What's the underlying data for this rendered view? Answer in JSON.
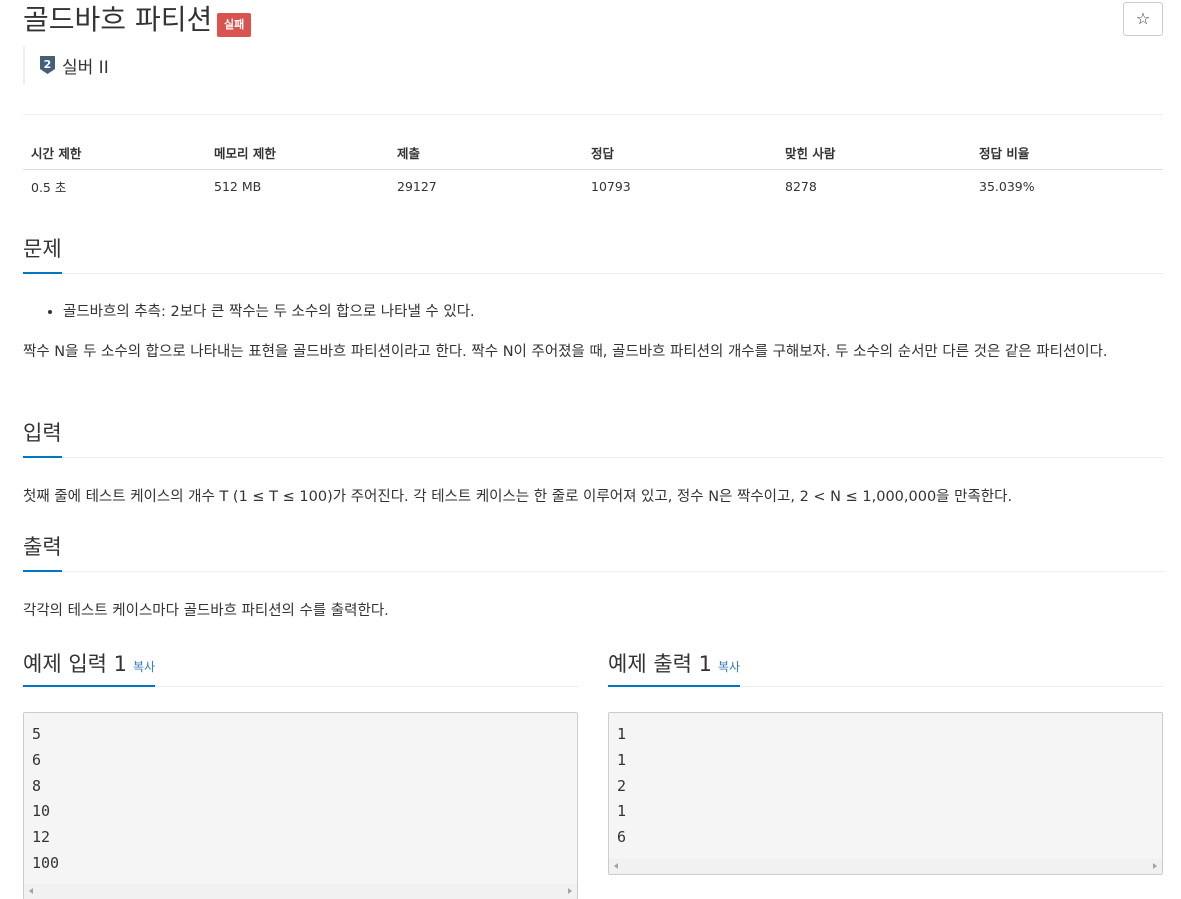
{
  "problem": {
    "title": "골드바흐 파티션",
    "status_badge": "실패",
    "tier_label": "실버 II",
    "tier_number": "2",
    "star_glyph": "☆"
  },
  "info_table": {
    "headers": [
      "시간 제한",
      "메모리 제한",
      "제출",
      "정답",
      "맞힌 사람",
      "정답 비율"
    ],
    "values": [
      "0.5 초",
      "512 MB",
      "29127",
      "10793",
      "8278",
      "35.039%"
    ]
  },
  "sections": {
    "description": {
      "heading": "문제",
      "bullet": "골드바흐의 추측: 2보다 큰 짝수는 두 소수의 합으로 나타낼 수 있다.",
      "paragraph": "짝수 N을 두 소수의 합으로 나타내는 표현을 골드바흐 파티션이라고 한다. 짝수 N이 주어졌을 때, 골드바흐 파티션의 개수를 구해보자. 두 소수의 순서만 다른 것은 같은 파티션이다."
    },
    "input": {
      "heading": "입력",
      "paragraph": "첫째 줄에 테스트 케이스의 개수 T (1 ≤ T ≤ 100)가 주어진다. 각 테스트 케이스는 한 줄로 이루어져 있고, 정수 N은 짝수이고, 2 < N ≤ 1,000,000을 만족한다."
    },
    "output": {
      "heading": "출력",
      "paragraph": "각각의 테스트 케이스마다 골드바흐 파티션의 수를 출력한다."
    }
  },
  "samples": {
    "input": {
      "heading": "예제 입력 1",
      "copy_label": "복사",
      "lines": [
        "5",
        "6",
        "8",
        "10",
        "12",
        "100"
      ]
    },
    "output": {
      "heading": "예제 출력 1",
      "copy_label": "복사",
      "lines": [
        "1",
        "1",
        "2",
        "1",
        "6"
      ]
    }
  },
  "colors": {
    "accent": "#0076c0",
    "fail_badge": "#d9534f",
    "tier_silver": "#435f7a",
    "link": "#337ab7"
  }
}
